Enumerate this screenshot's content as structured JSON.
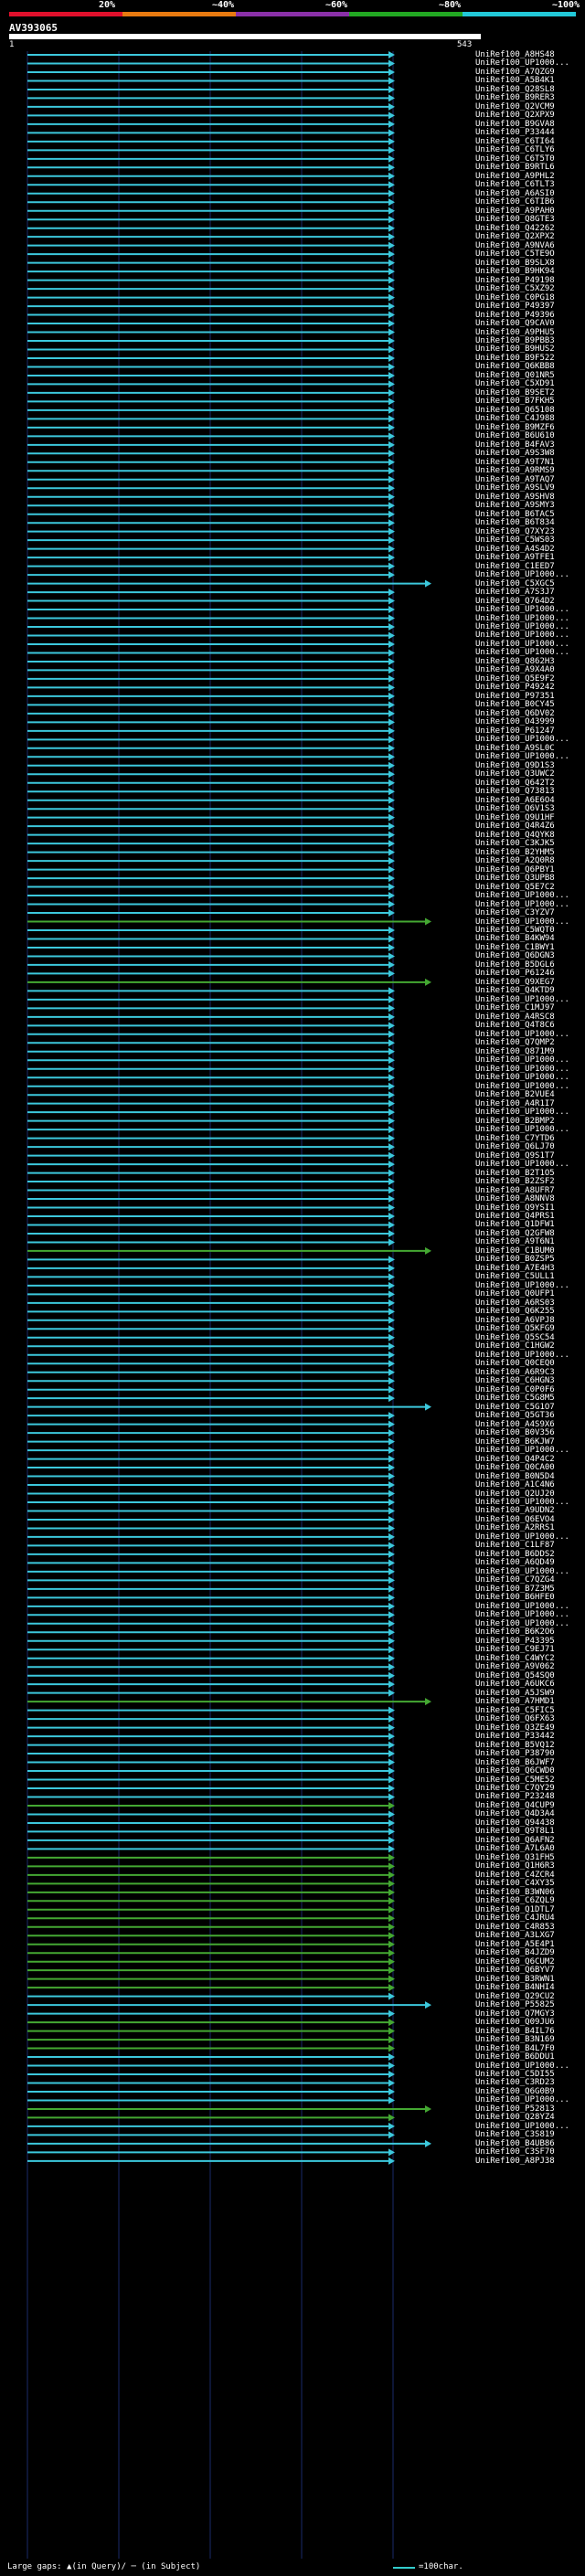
{
  "legend": [
    {
      "label": "20%",
      "color": "#e0102c"
    },
    {
      "label": "~40%",
      "color": "#e87a10"
    },
    {
      "label": "~60%",
      "color": "#8a30a8"
    },
    {
      "label": "~80%",
      "color": "#22a822"
    },
    {
      "label": "~100%",
      "color": "#22c8d8"
    }
  ],
  "query": {
    "id": "AV393065",
    "start": "1",
    "end": "543"
  },
  "colors": {
    "blue": "#3cc8dc",
    "green": "#44a832",
    "olive": "#5a7a1a",
    "grid": "#1a2a6a",
    "gap": "#222"
  },
  "hits": [
    {
      "label": "UniRef100_A8HS48",
      "c": "b"
    },
    {
      "label": "UniRef100_UP1000...",
      "c": "b"
    },
    {
      "label": "UniRef100_A7QZG9",
      "c": "b"
    },
    {
      "label": "UniRef100_A5B4K1",
      "c": "b"
    },
    {
      "label": "UniRef100_Q28SL8",
      "c": "b"
    },
    {
      "label": "UniRef100_B9RER3",
      "c": "b"
    },
    {
      "label": "UniRef100_Q2VCM9",
      "c": "b"
    },
    {
      "label": "UniRef100_Q2XPX9",
      "c": "b"
    },
    {
      "label": "UniRef100_B9GVA8",
      "c": "b"
    },
    {
      "label": "UniRef100_P33444",
      "c": "b"
    },
    {
      "label": "UniRef100_C6TI64",
      "c": "b"
    },
    {
      "label": "UniRef100_C6TLY6",
      "c": "b"
    },
    {
      "label": "UniRef100_C6T5T0",
      "c": "b"
    },
    {
      "label": "UniRef100_B9RTL6",
      "c": "b"
    },
    {
      "label": "UniRef100_A9PHL2",
      "c": "b"
    },
    {
      "label": "UniRef100_C6TLT3",
      "c": "b"
    },
    {
      "label": "UniRef100_A6ASI0",
      "c": "b"
    },
    {
      "label": "UniRef100_C6TIB6",
      "c": "b"
    },
    {
      "label": "UniRef100_A9PAH0",
      "c": "b"
    },
    {
      "label": "UniRef100_Q8GTE3",
      "c": "b"
    },
    {
      "label": "UniRef100_Q42262",
      "c": "b"
    },
    {
      "label": "UniRef100_Q2XPX2",
      "c": "b"
    },
    {
      "label": "UniRef100_A9NVA6",
      "c": "b"
    },
    {
      "label": "UniRef100_C5TE9O",
      "c": "b"
    },
    {
      "label": "UniRef100_B9SLX8",
      "c": "b"
    },
    {
      "label": "UniRef100_B9HK94",
      "c": "b"
    },
    {
      "label": "UniRef100_P49198",
      "c": "b"
    },
    {
      "label": "UniRef100_C5XZ92",
      "c": "b"
    },
    {
      "label": "UniRef100_C0PG18",
      "c": "b"
    },
    {
      "label": "UniRef100_P49397",
      "c": "b"
    },
    {
      "label": "UniRef100_P49396",
      "c": "b"
    },
    {
      "label": "UniRef100_Q9CAV0",
      "c": "b"
    },
    {
      "label": "UniRef100_A9PHU5",
      "c": "b"
    },
    {
      "label": "UniRef100_B9PBB3",
      "c": "b"
    },
    {
      "label": "UniRef100_B9HUS2",
      "c": "b"
    },
    {
      "label": "UniRef100_B9F522",
      "c": "b"
    },
    {
      "label": "UniRef100_Q6KBB8",
      "c": "b"
    },
    {
      "label": "UniRef100_Q01NR5",
      "c": "b"
    },
    {
      "label": "UniRef100_C5XD91",
      "c": "b"
    },
    {
      "label": "UniRef100_B9SET2",
      "c": "b"
    },
    {
      "label": "UniRef100_B7FKH5",
      "c": "b"
    },
    {
      "label": "UniRef100_Q65108",
      "c": "b"
    },
    {
      "label": "UniRef100_C4J988",
      "c": "b"
    },
    {
      "label": "UniRef100_B9MZF6",
      "c": "b"
    },
    {
      "label": "UniRef100_B6U610",
      "c": "b"
    },
    {
      "label": "UniRef100_B4FAV3",
      "c": "b"
    },
    {
      "label": "UniRef100_A9S3W8",
      "c": "b"
    },
    {
      "label": "UniRef100_A9T7N1",
      "c": "b"
    },
    {
      "label": "UniRef100_A9RMS9",
      "c": "b"
    },
    {
      "label": "UniRef100_A9TAQ7",
      "c": "b"
    },
    {
      "label": "UniRef100_A9SLV9",
      "c": "b"
    },
    {
      "label": "UniRef100_A9SHV8",
      "c": "b"
    },
    {
      "label": "UniRef100_A9SMY3",
      "c": "b"
    },
    {
      "label": "UniRef100_B6TAC5",
      "c": "b"
    },
    {
      "label": "UniRef100_B6T834",
      "c": "b"
    },
    {
      "label": "UniRef100_Q7XY23",
      "c": "b"
    },
    {
      "label": "UniRef100_C5WS03",
      "c": "b"
    },
    {
      "label": "UniRef100_A4S4D2",
      "c": "b"
    },
    {
      "label": "UniRef100_A9TFE1",
      "c": "b"
    },
    {
      "label": "UniRef100_C1EED7",
      "c": "b"
    },
    {
      "label": "UniRef100_UP1000...",
      "c": "b"
    },
    {
      "label": "UniRef100_C5XGC5",
      "c": "b",
      "ext": true
    },
    {
      "label": "UniRef100_A7S3J7",
      "c": "b"
    },
    {
      "label": "UniRef100_Q764D2",
      "c": "b"
    },
    {
      "label": "UniRef100_UP1000...",
      "c": "b"
    },
    {
      "label": "UniRef100_UP1000...",
      "c": "b"
    },
    {
      "label": "UniRef100_UP1000...",
      "c": "b"
    },
    {
      "label": "UniRef100_UP1000...",
      "c": "b"
    },
    {
      "label": "UniRef100_UP1000...",
      "c": "b"
    },
    {
      "label": "UniRef100_UP1000...",
      "c": "b"
    },
    {
      "label": "UniRef100_Q862H3",
      "c": "b"
    },
    {
      "label": "UniRef100_A9X4A0",
      "c": "b"
    },
    {
      "label": "UniRef100_Q5E9F2",
      "c": "b"
    },
    {
      "label": "UniRef100_P49242",
      "c": "b"
    },
    {
      "label": "UniRef100_P97351",
      "c": "b"
    },
    {
      "label": "UniRef100_B0CY45",
      "c": "b"
    },
    {
      "label": "UniRef100_Q6DV02",
      "c": "b"
    },
    {
      "label": "UniRef100_O43999",
      "c": "b"
    },
    {
      "label": "UniRef100_P61247",
      "c": "b"
    },
    {
      "label": "UniRef100_UP1000...",
      "c": "b"
    },
    {
      "label": "UniRef100_A9SL0C",
      "c": "b"
    },
    {
      "label": "UniRef100_UP1000...",
      "c": "b"
    },
    {
      "label": "UniRef100_Q9D1S3",
      "c": "b"
    },
    {
      "label": "UniRef100_Q3UWC2",
      "c": "b"
    },
    {
      "label": "UniRef100_Q642T2",
      "c": "b"
    },
    {
      "label": "UniRef100_Q73813",
      "c": "b"
    },
    {
      "label": "UniRef100_A6E6O4",
      "c": "b"
    },
    {
      "label": "UniRef100_Q6V1S3",
      "c": "b"
    },
    {
      "label": "UniRef100_Q9U1HF",
      "c": "b"
    },
    {
      "label": "UniRef100_Q4R4Z6",
      "c": "b"
    },
    {
      "label": "UniRef100_Q4QYK8",
      "c": "b"
    },
    {
      "label": "UniRef100_C3KJK5",
      "c": "b"
    },
    {
      "label": "UniRef100_B2YHM5",
      "c": "b"
    },
    {
      "label": "UniRef100_A2Q0R8",
      "c": "b"
    },
    {
      "label": "UniRef100_Q6PBY1",
      "c": "b"
    },
    {
      "label": "UniRef100_Q3UPB8",
      "c": "b"
    },
    {
      "label": "UniRef100_Q5E7C2",
      "c": "b"
    },
    {
      "label": "UniRef100_UP1000...",
      "c": "b"
    },
    {
      "label": "UniRef100_UP1000...",
      "c": "b"
    },
    {
      "label": "UniRef100_C3YZV7",
      "c": "b"
    },
    {
      "label": "UniRef100_UP1000...",
      "c": "g",
      "ext": true
    },
    {
      "label": "UniRef100_C5WQT0",
      "c": "b"
    },
    {
      "label": "UniRef100_B4KW94",
      "c": "b"
    },
    {
      "label": "UniRef100_C1BWY1",
      "c": "b"
    },
    {
      "label": "UniRef100_Q6DGN3",
      "c": "b"
    },
    {
      "label": "UniRef100_B5DGL6",
      "c": "b"
    },
    {
      "label": "UniRef100_P61246",
      "c": "b"
    },
    {
      "label": "UniRef100_Q9XEG7",
      "c": "g",
      "ext": true
    },
    {
      "label": "UniRef100_Q4KTD9",
      "c": "b"
    },
    {
      "label": "UniRef100_UP1000...",
      "c": "b"
    },
    {
      "label": "UniRef100_C1MJ97",
      "c": "b"
    },
    {
      "label": "UniRef100_A4RSC8",
      "c": "b"
    },
    {
      "label": "UniRef100_Q4T8C6",
      "c": "b"
    },
    {
      "label": "UniRef100_UP1000...",
      "c": "b"
    },
    {
      "label": "UniRef100_Q7QMP2",
      "c": "b"
    },
    {
      "label": "UniRef100_Q871M9",
      "c": "b"
    },
    {
      "label": "UniRef100_UP1000...",
      "c": "b"
    },
    {
      "label": "UniRef100_UP1000...",
      "c": "b"
    },
    {
      "label": "UniRef100_UP1000...",
      "c": "b"
    },
    {
      "label": "UniRef100_UP1000...",
      "c": "b"
    },
    {
      "label": "UniRef100_B2VUE4",
      "c": "b"
    },
    {
      "label": "UniRef100_A4R1I7",
      "c": "b"
    },
    {
      "label": "UniRef100_UP1000...",
      "c": "b"
    },
    {
      "label": "UniRef100_B2BMP2",
      "c": "b"
    },
    {
      "label": "UniRef100_UP1000...",
      "c": "b"
    },
    {
      "label": "UniRef100_C7YTD6",
      "c": "b"
    },
    {
      "label": "UniRef100_Q6LJ70",
      "c": "b"
    },
    {
      "label": "UniRef100_Q9S1T7",
      "c": "b"
    },
    {
      "label": "UniRef100_UP1000...",
      "c": "b"
    },
    {
      "label": "UniRef100_B2T1O5",
      "c": "b"
    },
    {
      "label": "UniRef100_B2ZSF2",
      "c": "b"
    },
    {
      "label": "UniRef100_A8UFR7",
      "c": "b"
    },
    {
      "label": "UniRef100_A8NNV8",
      "c": "b"
    },
    {
      "label": "UniRef100_Q9YSI1",
      "c": "b"
    },
    {
      "label": "UniRef100_Q4PRS1",
      "c": "b"
    },
    {
      "label": "UniRef100_Q1DFW1",
      "c": "b"
    },
    {
      "label": "UniRef100_Q2GFW8",
      "c": "b"
    },
    {
      "label": "UniRef100_A9T6N1",
      "c": "b"
    },
    {
      "label": "UniRef100_C1BUM0",
      "c": "g",
      "ext": true
    },
    {
      "label": "UniRef100_B0ZSP5",
      "c": "b"
    },
    {
      "label": "UniRef100_A7E4H3",
      "c": "b"
    },
    {
      "label": "UniRef100_C5ULL1",
      "c": "b"
    },
    {
      "label": "UniRef100_UP1000...",
      "c": "b"
    },
    {
      "label": "UniRef100_Q0UFP1",
      "c": "b"
    },
    {
      "label": "UniRef100_A6RS03",
      "c": "b"
    },
    {
      "label": "UniRef100_Q6K255",
      "c": "b"
    },
    {
      "label": "UniRef100_A6VPJ8",
      "c": "b"
    },
    {
      "label": "UniRef100_Q5KFG9",
      "c": "b"
    },
    {
      "label": "UniRef100_Q5SC54",
      "c": "b"
    },
    {
      "label": "UniRef100_C1HGW2",
      "c": "b"
    },
    {
      "label": "UniRef100_UP1000...",
      "c": "b"
    },
    {
      "label": "UniRef100_Q0CEQ0",
      "c": "b"
    },
    {
      "label": "UniRef100_A6R9C3",
      "c": "b"
    },
    {
      "label": "UniRef100_C6HGN3",
      "c": "b"
    },
    {
      "label": "UniRef100_C0P0F6",
      "c": "b"
    },
    {
      "label": "UniRef100_C5G8M5",
      "c": "b"
    },
    {
      "label": "UniRef100_C5G1O7",
      "c": "b",
      "ext": true
    },
    {
      "label": "UniRef100_Q5GT36",
      "c": "b"
    },
    {
      "label": "UniRef100_A4S9X6",
      "c": "b"
    },
    {
      "label": "UniRef100_B0V356",
      "c": "b"
    },
    {
      "label": "UniRef100_B6KJW7",
      "c": "b"
    },
    {
      "label": "UniRef100_UP1000...",
      "c": "b"
    },
    {
      "label": "UniRef100_Q4P4C2",
      "c": "b"
    },
    {
      "label": "UniRef100_Q0CA00",
      "c": "b"
    },
    {
      "label": "UniRef100_B0N5D4",
      "c": "b"
    },
    {
      "label": "UniRef100_A1C4N6",
      "c": "b"
    },
    {
      "label": "UniRef100_Q2UJ20",
      "c": "b"
    },
    {
      "label": "UniRef100_UP1000...",
      "c": "b"
    },
    {
      "label": "UniRef100_A9UDN2",
      "c": "b"
    },
    {
      "label": "UniRef100_Q6EVO4",
      "c": "b"
    },
    {
      "label": "UniRef100_A2RRS1",
      "c": "b"
    },
    {
      "label": "UniRef100_UP1000...",
      "c": "b"
    },
    {
      "label": "UniRef100_C1LF87",
      "c": "b"
    },
    {
      "label": "UniRef100_B6DDS2",
      "c": "b"
    },
    {
      "label": "UniRef100_A6QD49",
      "c": "b"
    },
    {
      "label": "UniRef100_UP1000...",
      "c": "b"
    },
    {
      "label": "UniRef100_C7QZG4",
      "c": "b"
    },
    {
      "label": "UniRef100_B7Z3M5",
      "c": "b"
    },
    {
      "label": "UniRef100_B6HFE0",
      "c": "b"
    },
    {
      "label": "UniRef100_UP1000...",
      "c": "b"
    },
    {
      "label": "UniRef100_UP1000...",
      "c": "b"
    },
    {
      "label": "UniRef100_UP1000...",
      "c": "b"
    },
    {
      "label": "UniRef100_B6K2O6",
      "c": "b"
    },
    {
      "label": "UniRef100_P43395",
      "c": "b"
    },
    {
      "label": "UniRef100_C9EJ71",
      "c": "b"
    },
    {
      "label": "UniRef100_C4WYC2",
      "c": "b"
    },
    {
      "label": "UniRef100_A9V062",
      "c": "b"
    },
    {
      "label": "UniRef100_Q54SQ0",
      "c": "b"
    },
    {
      "label": "UniRef100_A6UKC6",
      "c": "b"
    },
    {
      "label": "UniRef100_A5JSW9",
      "c": "b"
    },
    {
      "label": "UniRef100_A7HMD1",
      "c": "g",
      "ext": true
    },
    {
      "label": "UniRef100_C5FIC5",
      "c": "b"
    },
    {
      "label": "UniRef100_Q6FX63",
      "c": "b"
    },
    {
      "label": "UniRef100_Q3ZE49",
      "c": "b"
    },
    {
      "label": "UniRef100_P33442",
      "c": "b"
    },
    {
      "label": "UniRef100_B5VQ12",
      "c": "b"
    },
    {
      "label": "UniRef100_P38790",
      "c": "b"
    },
    {
      "label": "UniRef100_B6JWF7",
      "c": "b"
    },
    {
      "label": "UniRef100_Q6CWD0",
      "c": "b"
    },
    {
      "label": "UniRef100_C5ME52",
      "c": "b"
    },
    {
      "label": "UniRef100_C7QY29",
      "c": "b"
    },
    {
      "label": "UniRef100_P23248",
      "c": "b"
    },
    {
      "label": "UniRef100_Q4CUP9",
      "c": "g"
    },
    {
      "label": "UniRef100_Q4D3A4",
      "c": "b"
    },
    {
      "label": "UniRef100_Q94438",
      "c": "b"
    },
    {
      "label": "UniRef100_Q9T8L1",
      "c": "b"
    },
    {
      "label": "UniRef100_Q6AFN2",
      "c": "b"
    },
    {
      "label": "UniRef100_A7L6A0",
      "c": "b"
    },
    {
      "label": "UniRef100_Q31FH5",
      "c": "g"
    },
    {
      "label": "UniRef100_Q1H6R3",
      "c": "g"
    },
    {
      "label": "UniRef100_C4ZCR4",
      "c": "g"
    },
    {
      "label": "UniRef100_C4XY35",
      "c": "g"
    },
    {
      "label": "UniRef100_B3WN06",
      "c": "g"
    },
    {
      "label": "UniRef100_C6ZQL9",
      "c": "g"
    },
    {
      "label": "UniRef100_Q1DTL7",
      "c": "g"
    },
    {
      "label": "UniRef100_C4JRU4",
      "c": "g"
    },
    {
      "label": "UniRef100_C4R853",
      "c": "g"
    },
    {
      "label": "UniRef100_A3LXG7",
      "c": "g"
    },
    {
      "label": "UniRef100_A5E4P1",
      "c": "g"
    },
    {
      "label": "UniRef100_B4JZD9",
      "c": "g"
    },
    {
      "label": "UniRef100_Q6CUM2",
      "c": "g"
    },
    {
      "label": "UniRef100_Q6BYV7",
      "c": "g"
    },
    {
      "label": "UniRef100_B3RWN1",
      "c": "g"
    },
    {
      "label": "UniRef100_B4NHI4",
      "c": "g"
    },
    {
      "label": "UniRef100_Q29CU2",
      "c": "b"
    },
    {
      "label": "UniRef100_P55825",
      "c": "b",
      "ext": true
    },
    {
      "label": "UniRef100_Q7MGY3",
      "c": "b"
    },
    {
      "label": "UniRef100_Q09JU6",
      "c": "g"
    },
    {
      "label": "UniRef100_B4IL76",
      "c": "g"
    },
    {
      "label": "UniRef100_B3N169",
      "c": "g"
    },
    {
      "label": "UniRef100_B4L7F0",
      "c": "g"
    },
    {
      "label": "UniRef100_B6DDU1",
      "c": "b"
    },
    {
      "label": "UniRef100_UP1000...",
      "c": "b"
    },
    {
      "label": "UniRef100_C5DI55",
      "c": "b"
    },
    {
      "label": "UniRef100_C3RD23",
      "c": "b"
    },
    {
      "label": "UniRef100_Q6G0B9",
      "c": "b"
    },
    {
      "label": "UniRef100_UP1000...",
      "c": "b"
    },
    {
      "label": "UniRef100_P52813",
      "c": "g",
      "ext": true
    },
    {
      "label": "UniRef100_Q28YZ4",
      "c": "g"
    },
    {
      "label": "UniRef100_UP1000...",
      "c": "b"
    },
    {
      "label": "UniRef100_C3S819",
      "c": "b"
    },
    {
      "label": "UniRef100_B4UB86",
      "c": "b",
      "ext": true
    },
    {
      "label": "UniRef100_C3SF70",
      "c": "b"
    },
    {
      "label": "UniRef100_A8PJ38",
      "c": "b"
    }
  ],
  "footer": {
    "text": "Large gaps: ▲(in Query)/ ─ (in Subject)",
    "scale": "=100char."
  }
}
